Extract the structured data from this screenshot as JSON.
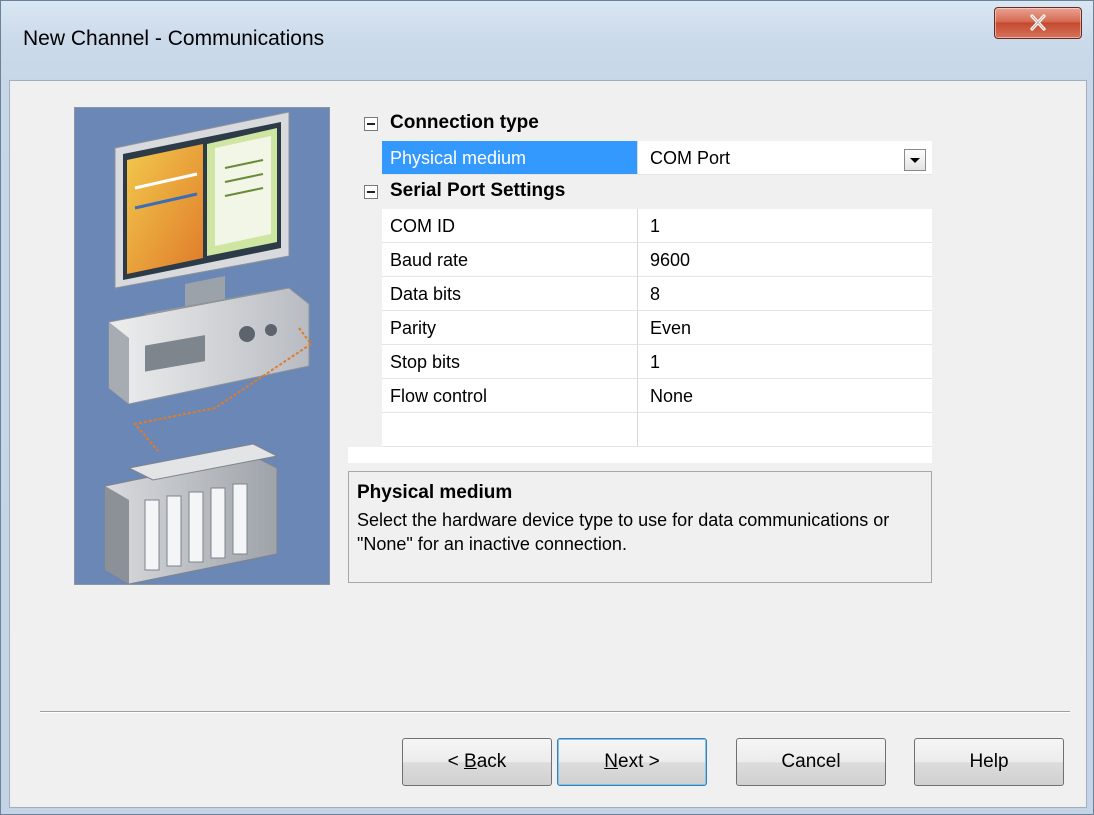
{
  "window": {
    "title": "New Channel - Communications"
  },
  "property_grid": {
    "categories": [
      {
        "label": "Connection type",
        "properties": [
          {
            "name": "Physical medium",
            "value": "COM Port",
            "selected": true
          }
        ]
      },
      {
        "label": "Serial Port Settings",
        "properties": [
          {
            "name": "COM ID",
            "value": "1"
          },
          {
            "name": "Baud rate",
            "value": "9600"
          },
          {
            "name": "Data bits",
            "value": "8"
          },
          {
            "name": "Parity",
            "value": "Even"
          },
          {
            "name": "Stop bits",
            "value": "1"
          },
          {
            "name": "Flow control",
            "value": "None"
          }
        ]
      }
    ]
  },
  "help": {
    "title": "Physical medium",
    "description": "Select the hardware device type to use for data communications or \"None\" for an inactive connection."
  },
  "buttons": {
    "back": {
      "prefix": "< ",
      "mnemonic": "B",
      "rest": "ack"
    },
    "next": {
      "mnemonic": "N",
      "rest": "ext >"
    },
    "cancel": "Cancel",
    "help": "Help"
  },
  "colors": {
    "selection": "#3399ff",
    "close_button": "#c44a2f",
    "illustration_bg": "#6b87b5"
  }
}
